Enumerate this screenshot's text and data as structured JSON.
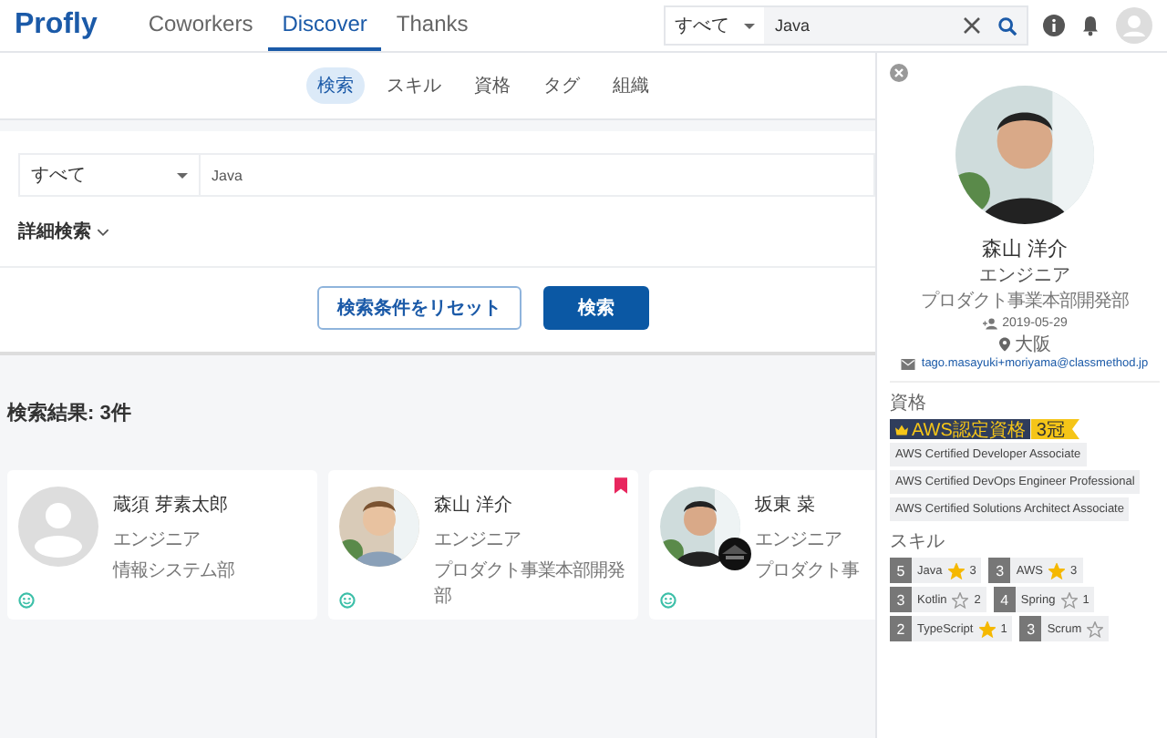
{
  "header": {
    "logo": "Profly",
    "nav": [
      {
        "label": "Coworkers",
        "selected": false
      },
      {
        "label": "Discover",
        "selected": true
      },
      {
        "label": "Thanks",
        "selected": false
      }
    ],
    "search": {
      "scope": "すべて",
      "value": "Java"
    }
  },
  "sub_tabs": [
    {
      "label": "検索",
      "selected": true
    },
    {
      "label": "スキル",
      "selected": false
    },
    {
      "label": "資格",
      "selected": false
    },
    {
      "label": "タグ",
      "selected": false
    },
    {
      "label": "組織",
      "selected": false
    }
  ],
  "search_form": {
    "scope": "すべて",
    "value": "Java",
    "advanced": "詳細検索",
    "reset_button": "検索条件をリセット",
    "search_button": "検索"
  },
  "results": {
    "title": "検索結果: 3件",
    "cards": [
      {
        "name": "蔵須 芽素太郎",
        "role": "エンジニア",
        "department": "情報システム部",
        "kind": "placeholder",
        "bookmarked": false,
        "extra_badge": false
      },
      {
        "name": "森山 洋介",
        "role": "エンジニア",
        "department": "プロダクト事業本部開発部",
        "kind": "picture",
        "bookmarked": true,
        "extra_badge": false
      },
      {
        "name": "坂東 菜",
        "role": "エンジニア",
        "department": "プロダクト事",
        "kind": "picture",
        "bookmarked": false,
        "extra_badge": true
      }
    ]
  },
  "profile": {
    "name": "森山 洋介",
    "role": "エンジニア",
    "department": "プロダクト事業本部開発部",
    "date": "2019-05-29",
    "location": "大阪",
    "email": "tago.masayuki+moriyama@classmethod.jp",
    "qualifications_label": "資格",
    "award": {
      "label": "AWS認定資格",
      "count": "3冠"
    },
    "certifications": [
      "AWS Certified Developer Associate",
      "AWS Certified DevOps Engineer Professional",
      "AWS Certified Solutions Architect Associate"
    ],
    "skills_label": "スキル",
    "skills": [
      {
        "rank": "5",
        "name": "Java",
        "starred": true,
        "count": "3"
      },
      {
        "rank": "3",
        "name": "AWS",
        "starred": true,
        "count": "3"
      },
      {
        "rank": "3",
        "name": "Kotlin",
        "starred": false,
        "count": "2"
      },
      {
        "rank": "4",
        "name": "Spring",
        "starred": false,
        "count": "1"
      },
      {
        "rank": "2",
        "name": "TypeScript",
        "starred": true,
        "count": "1"
      },
      {
        "rank": "3",
        "name": "Scrum",
        "starred": false
      }
    ]
  }
}
